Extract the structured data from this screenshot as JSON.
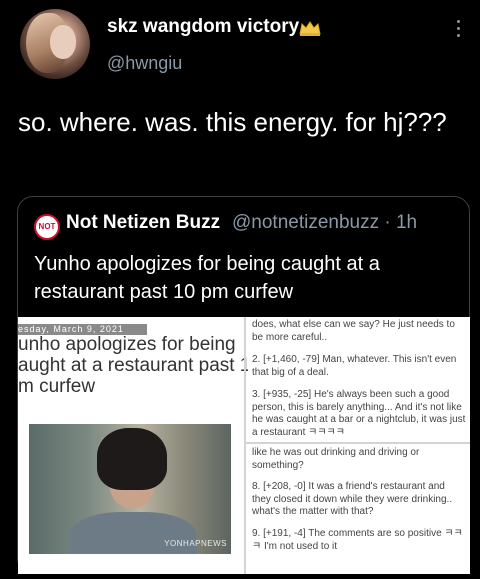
{
  "author": {
    "display_name": "skz wangdom victory",
    "handle": "@hwngiu"
  },
  "tweet": {
    "text": "so. where. was. this energy. for hj???"
  },
  "quoted": {
    "logo_text": "NOT",
    "display_name": "Not Netizen Buzz",
    "handle_time": "@notnetizenbuzz · 1h",
    "text": "Yunho apologizes for being caught at a restaurant past 10 pm curfew",
    "image": {
      "date": "esday, March 9, 2021",
      "headline_lines": [
        "unho apologizes for being",
        "aught at a restaurant past 10",
        "m curfew"
      ],
      "watermark": "YONHAPNEWS",
      "comments_top": [
        "does, what else can we say? He just needs to be more careful..",
        "2. [+1,460, -79] Man, whatever. This isn't even that big of a deal.",
        "3. [+935, -25] He's always been such a good person, this is barely anything... And it's not like he was caught at a bar or a nightclub, it was just a restaurant ㅋㅋㅋㅋ"
      ],
      "comments_bottom": [
        "like he was out drinking and driving or something?",
        "8. [+208, -0] It was a friend's restaurant and they closed it down while they were drinking.. what's the matter with that?",
        "9. [+191, -4] The comments are so positive ㅋㅋ ㅋ I'm not used to it"
      ]
    }
  },
  "icons": [
    "avatar",
    "crown-emoji-icon",
    "more-options-icon",
    "not-logo-icon"
  ]
}
